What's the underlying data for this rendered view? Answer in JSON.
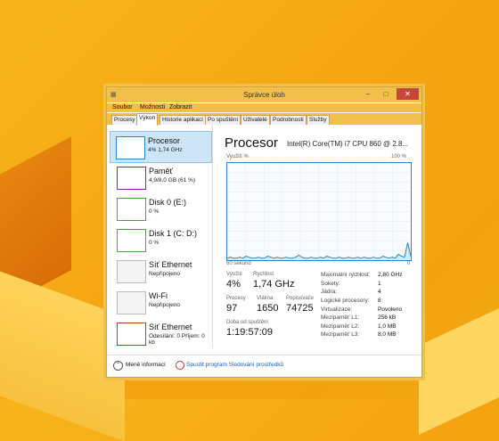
{
  "window": {
    "title": "Správce úloh"
  },
  "menu": [
    "Soubor",
    "Možnosti",
    "Zobrazit"
  ],
  "tabs": [
    "Procesy",
    "Výkon",
    "Historie aplikací",
    "Po spuštění",
    "Uživatelé",
    "Podrobnosti",
    "Služby"
  ],
  "sidebar": [
    {
      "name": "Procesor",
      "sub": "4% 1,74 GHz"
    },
    {
      "name": "Paměť",
      "sub": "4,9/8,0 GB (61 %)"
    },
    {
      "name": "Disk 0 (E:)",
      "sub": "0 %"
    },
    {
      "name": "Disk 1 (C: D:)",
      "sub": "0 %"
    },
    {
      "name": "Síť Ethernet",
      "sub": "Nepřipojeno"
    },
    {
      "name": "Wi-Fi",
      "sub": "Nepřipojeno"
    },
    {
      "name": "Síť Ethernet",
      "sub": "Odesílání: 0 Příjem: 0 kb"
    }
  ],
  "main": {
    "title": "Procesor",
    "cpu_name": "Intel(R) Core(TM) i7 CPU 860 @ 2.8...",
    "graph_label": "Využití %",
    "graph_max": "100 %",
    "graph_time": "60 sekund",
    "graph_zero": "0"
  },
  "stats": {
    "util_label": "Využití",
    "util_value": "4%",
    "speed_label": "Rychlost",
    "speed_value": "1,74 GHz",
    "proc_label": "Procesy",
    "proc_value": "97",
    "threads_label": "Vlákna",
    "threads_value": "1650",
    "handles_label": "Popisovače",
    "handles_value": "74725",
    "uptime_label": "Doba od spuštění",
    "uptime_value": "1:19:57:09"
  },
  "specs": [
    {
      "k": "Maximální rychlost:",
      "v": "2,80 GHz"
    },
    {
      "k": "Sokety:",
      "v": "1"
    },
    {
      "k": "Jádra:",
      "v": "4"
    },
    {
      "k": "Logické procesory:",
      "v": "8"
    },
    {
      "k": "Virtualizace:",
      "v": "Povoleno"
    },
    {
      "k": "Mezipaměť L1:",
      "v": "256 kB"
    },
    {
      "k": "Mezipaměť L2:",
      "v": "1,0 MB"
    },
    {
      "k": "Mezipaměť L3:",
      "v": "8,0 MB"
    }
  ],
  "bottom": {
    "less_info": "Méně informací",
    "open_monitor": "Spustit program Sledování prostředků"
  },
  "colors": {
    "accent": "#f1c04b",
    "cpu_graph": "#2b86cc",
    "memory": "#8b1fa9",
    "disk": "#4da53f",
    "network": "#a7471a"
  },
  "cpu_usage_series": [
    2,
    3,
    2,
    2,
    3,
    2,
    4,
    3,
    2,
    2,
    3,
    2,
    2,
    4,
    3,
    2,
    3,
    2,
    2,
    3,
    2,
    2,
    3,
    5,
    3,
    2,
    2,
    3,
    2,
    2,
    3,
    2,
    4,
    3,
    2,
    2,
    3,
    2,
    2,
    3,
    2,
    2,
    3,
    2,
    3,
    2,
    2,
    3,
    2,
    2,
    4,
    3,
    2,
    3,
    2,
    6,
    4,
    3,
    18,
    4
  ]
}
